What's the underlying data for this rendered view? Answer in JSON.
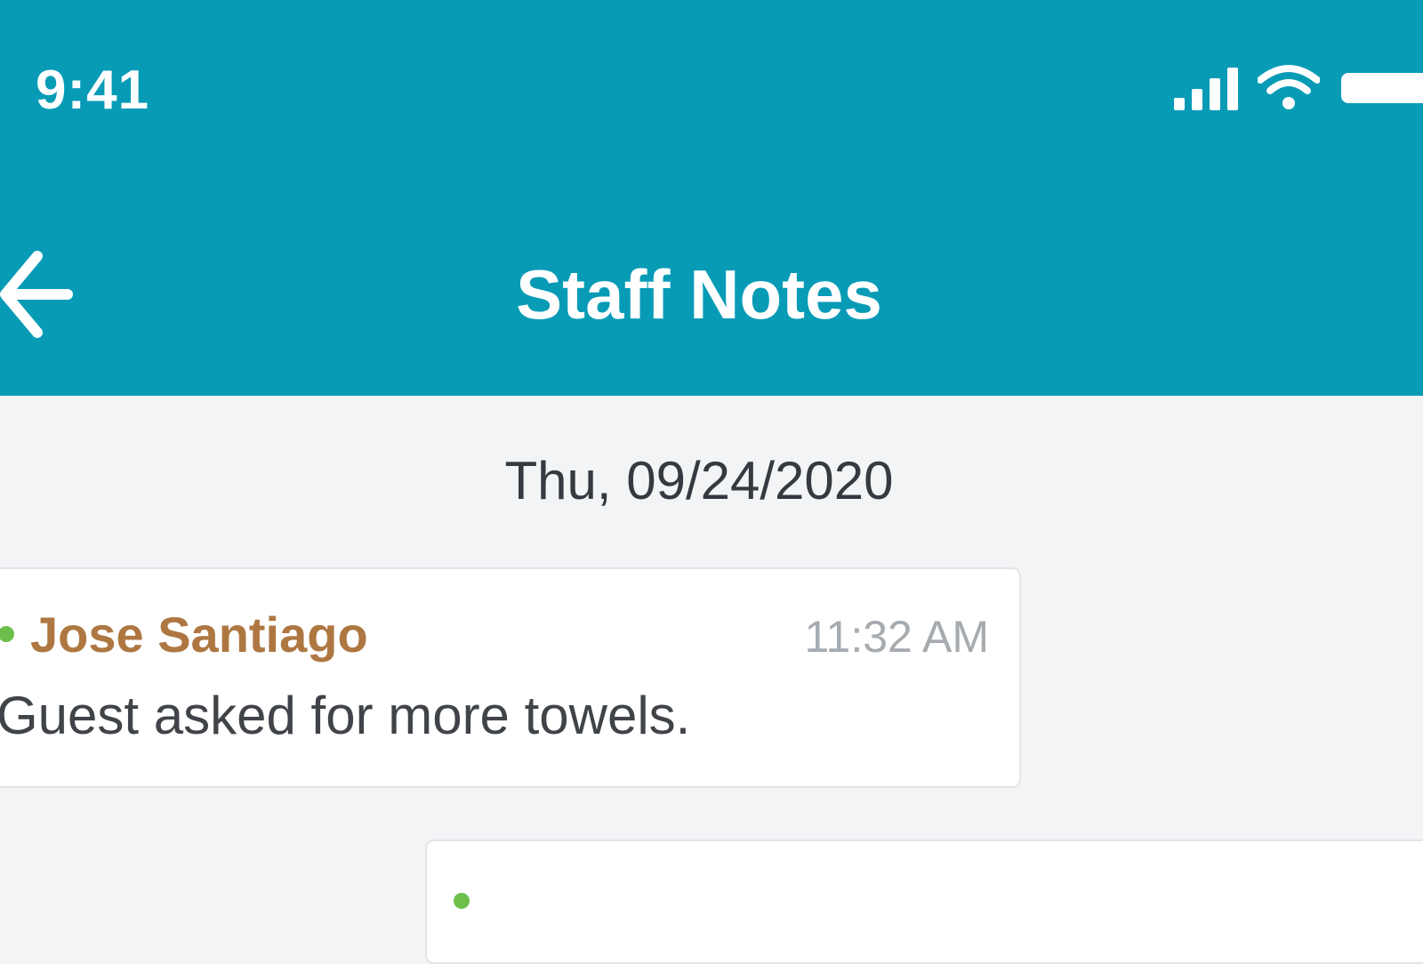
{
  "status_bar": {
    "time": "9:41",
    "icons": [
      "cellular-signal-icon",
      "wifi-icon",
      "battery-icon"
    ]
  },
  "header": {
    "title": "Staff Notes",
    "back_icon": "arrow-left-icon"
  },
  "date_label": "Thu, 09/24/2020",
  "notes": [
    {
      "author": "Jose Santiago",
      "time": "11:32 AM",
      "text": "Guest asked for more towels.",
      "presence": "online"
    },
    {
      "author": "",
      "time": "",
      "text": "",
      "presence": "online"
    }
  ],
  "colors": {
    "header_bg": "#079bb6",
    "page_bg": "#f3f4f6",
    "author": "#ae7742",
    "presence": "#6dbf4b",
    "muted": "#a6abb0"
  }
}
